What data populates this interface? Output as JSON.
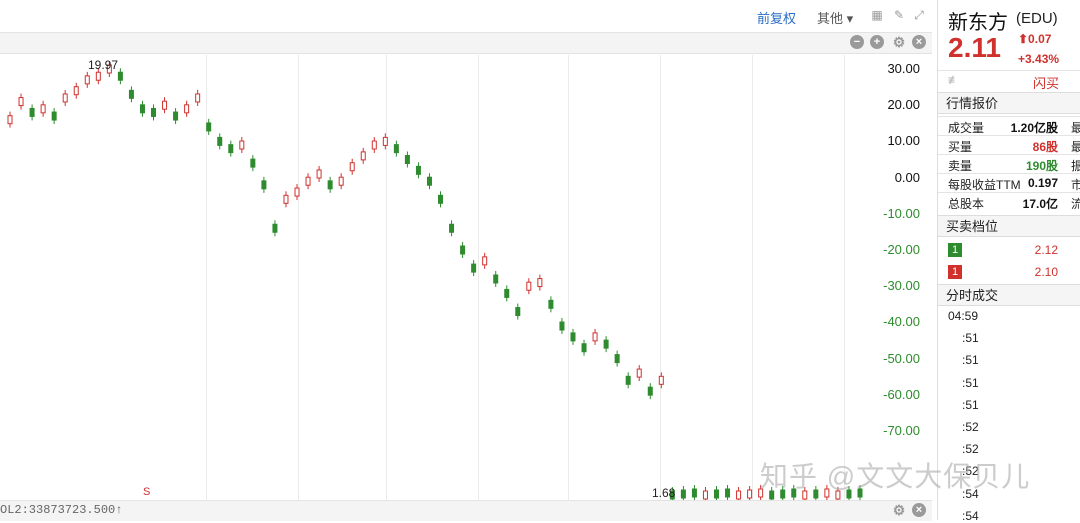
{
  "toolbar": {
    "adjust_label": "前复权",
    "other_label": "其他 ▾"
  },
  "chart": {
    "y_ticks": [
      "30.00",
      "20.00",
      "10.00",
      "0.00",
      "-10.00",
      "-20.00",
      "-30.00",
      "-40.00",
      "-50.00",
      "-60.00",
      "-70.00"
    ],
    "max_annotation": "19.97",
    "min_annotation": "1.68",
    "event_marker": "S",
    "volume_text": "OL2:33873723.500↑",
    "watermark": "知乎 @文文大保贝儿",
    "colors": {
      "up": "#d0312d",
      "down": "#2e8b2e",
      "grid": "#ebebeb"
    }
  },
  "chart_data": {
    "type": "candlestick",
    "ylabel_unit": "percent",
    "ylim": [
      -75,
      33
    ],
    "y_ticks": [
      30,
      20,
      10,
      0,
      -10,
      -20,
      -30,
      -40,
      -50,
      -60,
      -70
    ],
    "annotations": {
      "max_price": "19.97",
      "min_price": "1.68"
    },
    "series": [
      {
        "values": [
          16,
          21,
          18,
          19,
          17,
          22,
          24,
          27,
          28,
          30,
          28,
          23,
          19,
          18,
          20,
          17,
          19,
          22,
          14,
          10,
          8,
          9,
          4,
          -2,
          -14,
          -6,
          -4,
          -1,
          1,
          -2,
          -1,
          3,
          6,
          9,
          10,
          8,
          5,
          2,
          -1,
          -6,
          -14,
          -20,
          -25,
          -23,
          -28,
          -32,
          -37,
          -30,
          -29,
          -35,
          -41,
          -44,
          -47,
          -44,
          -46,
          -50,
          -56,
          -54,
          -59,
          -56,
          -90,
          -91,
          -92,
          -92,
          -93,
          -94,
          -93,
          -92,
          -91,
          -92,
          -93,
          -94,
          -92,
          -93,
          -92,
          -91,
          -92,
          -93
        ]
      }
    ]
  },
  "quote": {
    "name": "新东方",
    "code": "(EDU)",
    "price": "2.11",
    "change": "⬆0.07",
    "change_pct": "+3.43%",
    "flash_buy": "闪买",
    "section_quote": "行情报价",
    "rows": [
      {
        "label": "成交量",
        "value": "1.20亿股",
        "tail": "最",
        "color": "#111"
      },
      {
        "label": "买量",
        "value": "86股",
        "tail": "最",
        "color": "#d0312d"
      },
      {
        "label": "卖量",
        "value": "190股",
        "tail": "振",
        "color": "#2e8b2e"
      },
      {
        "label": "每股收益TTM",
        "value": "0.197",
        "tail": "市",
        "color": "#111"
      },
      {
        "label": "总股本",
        "value": "17.0亿",
        "tail": "流",
        "color": "#111"
      }
    ],
    "section_book": "买卖档位",
    "book": [
      {
        "badge": "1",
        "price": "2.12",
        "badge_color": "#2e8b2e"
      },
      {
        "badge": "1",
        "price": "2.10",
        "badge_color": "#d0312d"
      }
    ],
    "section_ts": "分时成交",
    "ticks": [
      "04:59",
      ":51",
      ":51",
      ":51",
      ":51",
      ":52",
      ":52",
      ":52",
      ":54",
      ":54"
    ]
  }
}
